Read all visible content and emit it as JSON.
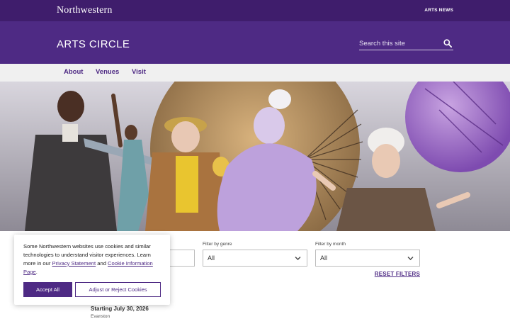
{
  "topbar": {
    "logo": "Northwestern",
    "arts_news": "ARTS NEWS"
  },
  "header": {
    "site_title": "ARTS CIRCLE",
    "search_placeholder": "Search this site",
    "search_icon": "search-icon"
  },
  "nav": {
    "items": [
      {
        "label": "About"
      },
      {
        "label": "Venues"
      },
      {
        "label": "Visit"
      }
    ]
  },
  "filters": {
    "genre": {
      "label": "Filter by genre",
      "value": "All"
    },
    "month": {
      "label": "Filter by month",
      "value": "All"
    },
    "reset": "RESET FILTERS"
  },
  "event": {
    "date": "Starting July 30, 2026",
    "location": "Evanston"
  },
  "cookie": {
    "text_before": "Some Northwestern websites use cookies and similar technologies to understand visitor experiences. Learn more in our ",
    "privacy_link": "Privacy Statement",
    "text_middle": " and ",
    "cookie_link": "Cookie Information Page",
    "text_after": ".",
    "accept": "Accept All",
    "adjust": "Adjust or Reject Cookies"
  },
  "colors": {
    "brand_purple": "#4e2a84",
    "dark_purple": "#3f1d6c"
  }
}
